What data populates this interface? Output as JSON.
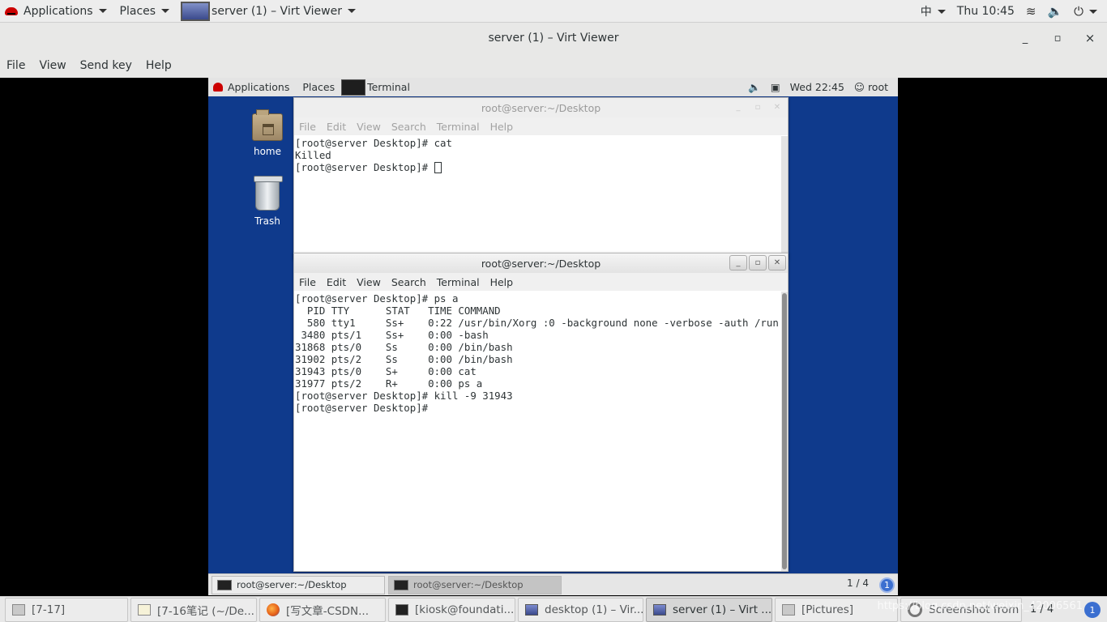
{
  "host_topbar": {
    "applications": "Applications",
    "places": "Places",
    "active_app": "server (1) – Virt Viewer",
    "input_method": "中",
    "clock": "Thu 10:45"
  },
  "window": {
    "title": "server (1) – Virt Viewer",
    "min": "_",
    "max": "▫",
    "close": "×",
    "menu": [
      "File",
      "View",
      "Send key",
      "Help"
    ]
  },
  "guest": {
    "topbar": {
      "applications": "Applications",
      "places": "Places",
      "app": "Terminal",
      "clock": "Wed 22:45",
      "user": "root"
    },
    "desktop_icons": {
      "home": "home",
      "trash": "Trash"
    },
    "terminal_back": {
      "title": "root@server:~/Desktop",
      "menu": [
        "File",
        "Edit",
        "View",
        "Search",
        "Terminal",
        "Help"
      ],
      "lines": [
        "[root@server Desktop]# cat",
        "Killed",
        "[root@server Desktop]# "
      ]
    },
    "terminal_front": {
      "title": "root@server:~/Desktop",
      "menu": [
        "File",
        "Edit",
        "View",
        "Search",
        "Terminal",
        "Help"
      ],
      "lines": [
        "[root@server Desktop]# ps a",
        "  PID TTY      STAT   TIME COMMAND",
        "  580 tty1     Ss+    0:22 /usr/bin/Xorg :0 -background none -verbose -auth /run",
        " 3480 pts/1    Ss+    0:00 -bash",
        "31868 pts/0    Ss     0:00 /bin/bash",
        "31902 pts/2    Ss     0:00 /bin/bash",
        "31943 pts/0    S+     0:00 cat",
        "31977 pts/2    R+     0:00 ps a",
        "[root@server Desktop]# kill -9 31943",
        "[root@server Desktop]# "
      ]
    },
    "taskbar": {
      "items": [
        "root@server:~/Desktop",
        "root@server:~/Desktop"
      ],
      "pager": "1 / 4",
      "notifications": "1"
    }
  },
  "host_taskbar": {
    "items": [
      "[7-17]",
      "[7-16笔记 (~/De...",
      "[写文章-CSDN...",
      "[kiosk@foundati...",
      "desktop (1) – Vir...",
      "server (1) – Virt ...",
      "[Pictures]",
      "Screenshot from ..."
    ],
    "pager": "1 / 4",
    "watermark": "https://blog.csdn.net/weixin_42006561",
    "notifications": "1"
  }
}
